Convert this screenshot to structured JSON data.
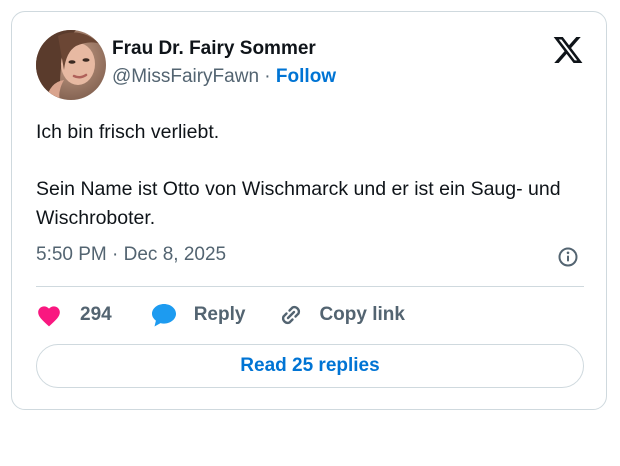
{
  "author": {
    "display_name": "Frau Dr. Fairy Sommer",
    "handle": "@MissFairyFawn",
    "separator": " · ",
    "follow_label": "Follow"
  },
  "tweet": {
    "text": "Ich bin frisch verliebt.\n\nSein Name ist Otto von Wischmarck und er ist ein Saug- und Wischroboter.",
    "timestamp": "5:50 PM · Dec 8, 2025"
  },
  "actions": {
    "like_count": "294",
    "reply_label": "Reply",
    "copy_label": "Copy link"
  },
  "read_replies_label": "Read 25 replies",
  "icons": {
    "brand": "x-logo-icon",
    "info": "info-icon",
    "like": "heart-icon",
    "reply": "speech-bubble-icon",
    "copy": "link-icon"
  },
  "colors": {
    "accent": "#0074d4",
    "like": "#f91880",
    "reply": "#1d9bf0",
    "muted": "#536471",
    "border": "#cfd9de"
  }
}
